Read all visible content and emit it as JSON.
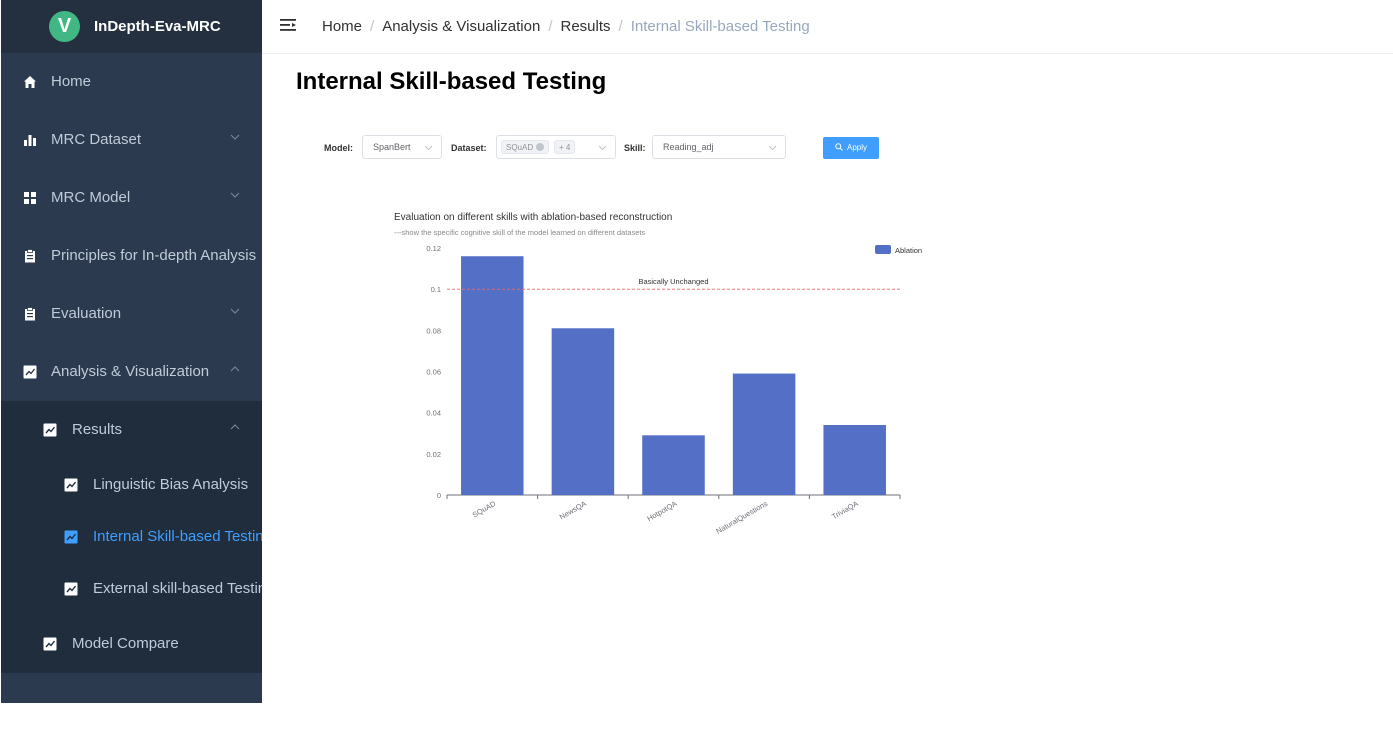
{
  "app": {
    "logo_letter": "V",
    "title": "InDepth-Eva-MRC"
  },
  "sidebar": {
    "items": [
      {
        "label": "Home",
        "icon": "home-icon"
      },
      {
        "label": "MRC Dataset",
        "icon": "bar-chart-icon"
      },
      {
        "label": "MRC Model",
        "icon": "grid-icon"
      },
      {
        "label": "Principles for In-depth Analysis",
        "icon": "clipboard-icon"
      },
      {
        "label": "Evaluation",
        "icon": "clipboard-icon"
      },
      {
        "label": "Analysis & Visualization",
        "icon": "chart-icon"
      },
      {
        "label": "Results",
        "icon": "chart-icon"
      },
      {
        "label": "Linguistic Bias Analysis",
        "icon": "chart-icon"
      },
      {
        "label": "Internal Skill-based Testing",
        "icon": "chart-icon"
      },
      {
        "label": "External skill-based Testing",
        "icon": "chart-icon"
      },
      {
        "label": "Model Compare",
        "icon": "chart-icon"
      }
    ],
    "active_color": "#409eff"
  },
  "breadcrumb": {
    "items": [
      "Home",
      "Analysis & Visualization",
      "Results",
      "Internal Skill-based Testing"
    ],
    "separator": "/"
  },
  "page": {
    "title": "Internal Skill-based Testing"
  },
  "filters": {
    "model_label": "Model:",
    "model_value": "SpanBert",
    "dataset_label": "Dataset:",
    "dataset_tag": "SQuAD",
    "dataset_more": "+ 4",
    "skill_label": "Skill:",
    "skill_value": "Reading_adj",
    "apply_label": "Apply"
  },
  "chart_data": {
    "type": "bar",
    "title": "Evaluation on different skills with ablation-based reconstruction",
    "subtitle": "---show the specific cognitive skill of the model learned on different datasets",
    "categories": [
      "SQuAD",
      "NewsQA",
      "HotpotQA",
      "NaturalQuestions",
      "TriviaQA"
    ],
    "series": [
      {
        "name": "Ablation",
        "values": [
          0.116,
          0.081,
          0.029,
          0.059,
          0.034
        ],
        "color": "#5470c6"
      }
    ],
    "ylim": [
      0,
      0.12
    ],
    "yticks": [
      "0",
      "0.02",
      "0.04",
      "0.06",
      "0.08",
      "0.1",
      "0.12"
    ],
    "reference_line": {
      "value": 0.1,
      "label": "Basically Unchanged",
      "color": "#ee6666"
    },
    "grid": false,
    "legend_position": "top-right"
  }
}
